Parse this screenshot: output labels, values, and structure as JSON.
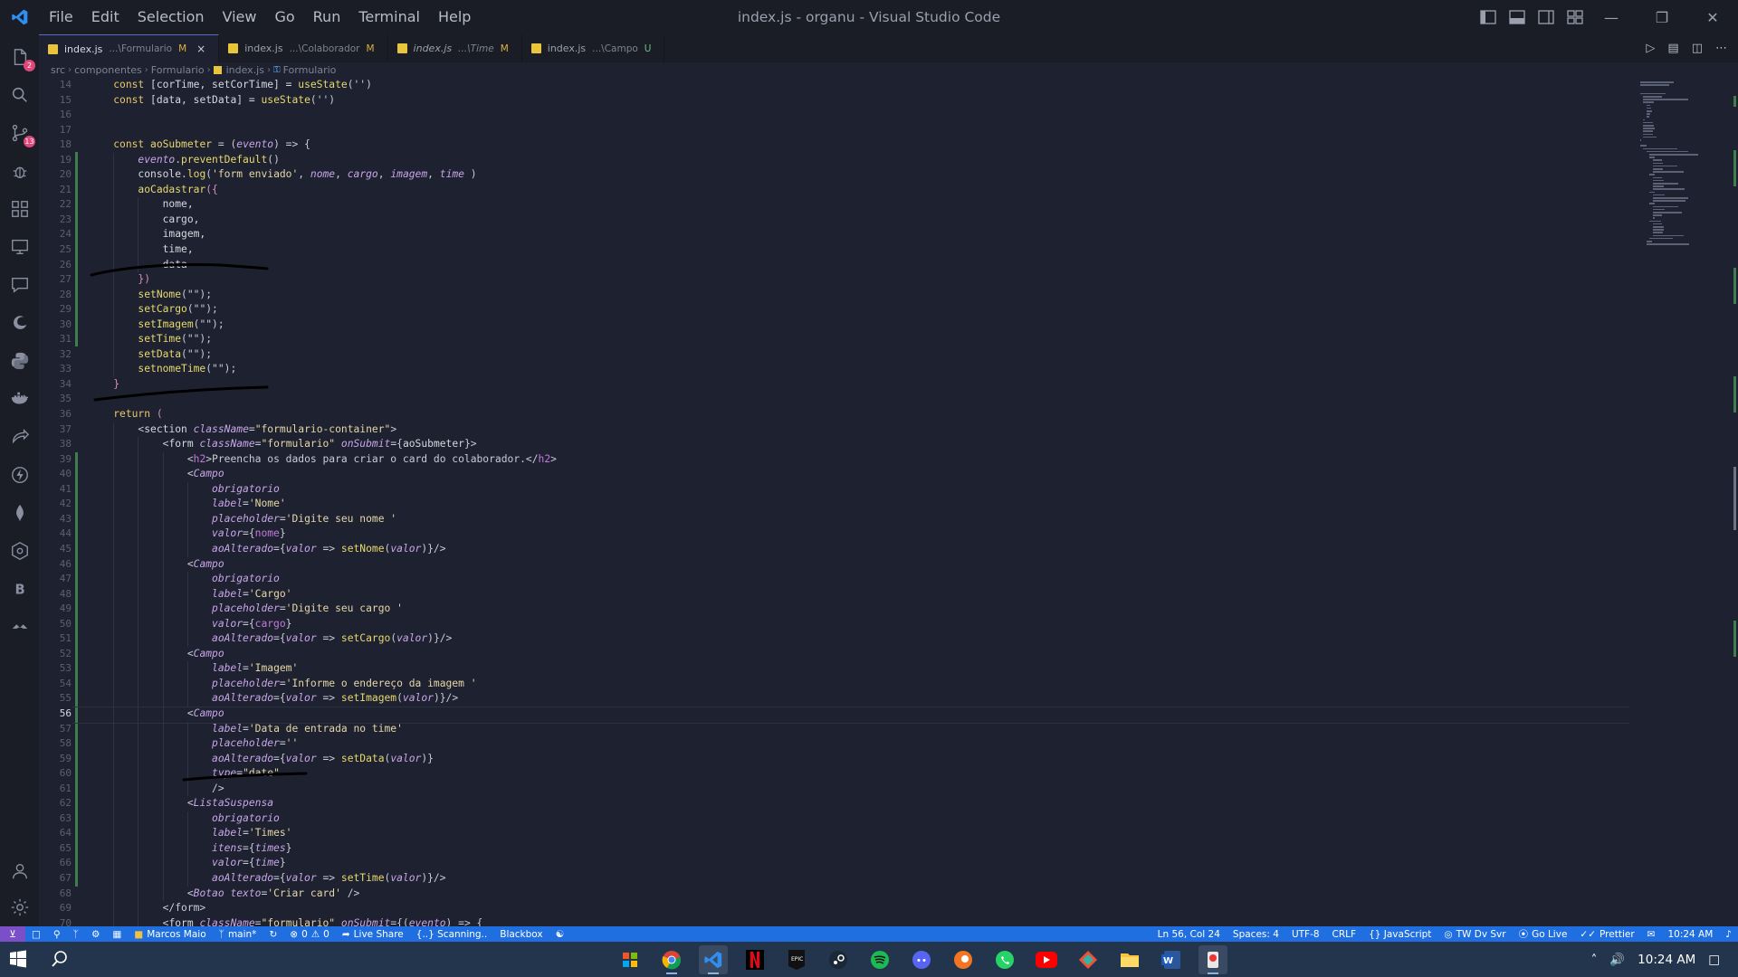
{
  "window": {
    "title": "index.js - organu - Visual Studio Code"
  },
  "menu": [
    "File",
    "Edit",
    "Selection",
    "View",
    "Go",
    "Run",
    "Terminal",
    "Help"
  ],
  "activity_badges": {
    "explorer": "2",
    "scm": "13"
  },
  "tabs": [
    {
      "name": "index.js",
      "path": "...\\Formulario",
      "status": "M",
      "active": true,
      "italic": false,
      "close": "×"
    },
    {
      "name": "index.js",
      "path": "...\\Colaborador",
      "status": "M",
      "active": false,
      "italic": false,
      "close": ""
    },
    {
      "name": "index.js",
      "path": "...\\Time",
      "status": "M",
      "active": false,
      "italic": true,
      "close": ""
    },
    {
      "name": "index.js",
      "path": "...\\Campo",
      "status": "U",
      "active": false,
      "italic": false,
      "close": ""
    }
  ],
  "breadcrumb": [
    "src",
    "componentes",
    "Formulario",
    "index.js",
    "Formulario"
  ],
  "editor": {
    "first_line": 14,
    "current_line": 56,
    "lines": [
      [
        [
          "    ",
          "p"
        ],
        [
          "const ",
          "kw"
        ],
        [
          "[corTime, setCorTime] = ",
          "v"
        ],
        [
          "useState",
          "fn"
        ],
        [
          "('')",
          "p"
        ]
      ],
      [
        [
          "    ",
          "p"
        ],
        [
          "const ",
          "kw"
        ],
        [
          "[data, setData] = ",
          "v"
        ],
        [
          "useState",
          "fn"
        ],
        [
          "('')",
          "p"
        ]
      ],
      [],
      [],
      [
        [
          "    ",
          "p"
        ],
        [
          "const ",
          "kw"
        ],
        [
          "aoSubmeter",
          "fn"
        ],
        [
          " = (",
          "p"
        ],
        [
          "evento",
          "it"
        ],
        [
          ") => {",
          "p"
        ]
      ],
      [
        [
          "        ",
          "p"
        ],
        [
          "evento",
          "it"
        ],
        [
          ".",
          "p"
        ],
        [
          "preventDefault",
          "fn"
        ],
        [
          "()",
          "p"
        ]
      ],
      [
        [
          "        ",
          "p"
        ],
        [
          "console",
          "v"
        ],
        [
          ".",
          "p"
        ],
        [
          "log",
          "fn"
        ],
        [
          "(",
          "p"
        ],
        [
          "'form enviado'",
          "str"
        ],
        [
          ", ",
          "p"
        ],
        [
          "nome",
          "it"
        ],
        [
          ", ",
          "p"
        ],
        [
          "cargo",
          "it"
        ],
        [
          ", ",
          "p"
        ],
        [
          "imagem",
          "it"
        ],
        [
          ", ",
          "p"
        ],
        [
          "time",
          "it"
        ],
        [
          " )",
          "p"
        ]
      ],
      [
        [
          "        ",
          "p"
        ],
        [
          "aoCadastrar",
          "fn"
        ],
        [
          "({",
          "br"
        ]
      ],
      [
        [
          "            ",
          "p"
        ],
        [
          "nome,",
          "v"
        ]
      ],
      [
        [
          "            ",
          "p"
        ],
        [
          "cargo,",
          "v"
        ]
      ],
      [
        [
          "            ",
          "p"
        ],
        [
          "imagem,",
          "v"
        ]
      ],
      [
        [
          "            ",
          "p"
        ],
        [
          "time,",
          "v"
        ]
      ],
      [
        [
          "            ",
          "p"
        ],
        [
          "data",
          "v"
        ]
      ],
      [
        [
          "        ",
          "p"
        ],
        [
          "})",
          "br"
        ]
      ],
      [
        [
          "        ",
          "p"
        ],
        [
          "setNome",
          "fn"
        ],
        [
          "(\"\");",
          "p"
        ]
      ],
      [
        [
          "        ",
          "p"
        ],
        [
          "setCargo",
          "fn"
        ],
        [
          "(\"\");",
          "p"
        ]
      ],
      [
        [
          "        ",
          "p"
        ],
        [
          "setImagem",
          "fn"
        ],
        [
          "(\"\");",
          "p"
        ]
      ],
      [
        [
          "        ",
          "p"
        ],
        [
          "setTime",
          "fn"
        ],
        [
          "(\"\");",
          "p"
        ]
      ],
      [
        [
          "        ",
          "p"
        ],
        [
          "setData",
          "fn"
        ],
        [
          "(\"\");",
          "p"
        ]
      ],
      [
        [
          "        ",
          "p"
        ],
        [
          "setnomeTime",
          "fn"
        ],
        [
          "(\"\");",
          "p"
        ]
      ],
      [
        [
          "    ",
          "p"
        ],
        [
          "}",
          "br"
        ]
      ],
      [],
      [
        [
          "    ",
          "p"
        ],
        [
          "return ",
          "kw"
        ],
        [
          "(",
          "br"
        ]
      ],
      [
        [
          "        ",
          "p"
        ],
        [
          "<",
          "p"
        ],
        [
          "section ",
          "v"
        ],
        [
          "className",
          "attr"
        ],
        [
          "=",
          "p"
        ],
        [
          "\"formulario-container\"",
          "str"
        ],
        [
          ">",
          "p"
        ]
      ],
      [
        [
          "            ",
          "p"
        ],
        [
          "<",
          "p"
        ],
        [
          "form ",
          "v"
        ],
        [
          "className",
          "attr"
        ],
        [
          "=",
          "p"
        ],
        [
          "\"formulario\" ",
          "str"
        ],
        [
          "onSubmit",
          "attr"
        ],
        [
          "={",
          "p"
        ],
        [
          "aoSubmeter",
          "v"
        ],
        [
          "}>",
          "p"
        ]
      ],
      [
        [
          "                ",
          "p"
        ],
        [
          "<",
          "p"
        ],
        [
          "h2",
          "pl"
        ],
        [
          ">Preencha os dados para criar o card do colaborador.</",
          "p"
        ],
        [
          "h2",
          "pl"
        ],
        [
          ">",
          "p"
        ]
      ],
      [
        [
          "                ",
          "p"
        ],
        [
          "<",
          "p"
        ],
        [
          "Campo",
          "tag"
        ]
      ],
      [
        [
          "                    ",
          "p"
        ],
        [
          "obrigatorio",
          "attr"
        ]
      ],
      [
        [
          "                    ",
          "p"
        ],
        [
          "label",
          "attr"
        ],
        [
          "=",
          "p"
        ],
        [
          "'Nome'",
          "str"
        ]
      ],
      [
        [
          "                    ",
          "p"
        ],
        [
          "placeholder",
          "attr"
        ],
        [
          "=",
          "p"
        ],
        [
          "'Digite seu nome '",
          "str"
        ]
      ],
      [
        [
          "                    ",
          "p"
        ],
        [
          "valor",
          "attr"
        ],
        [
          "={",
          "p"
        ],
        [
          "nome",
          "pl"
        ],
        [
          "}",
          "p"
        ]
      ],
      [
        [
          "                    ",
          "p"
        ],
        [
          "aoAlterado",
          "attr"
        ],
        [
          "={",
          "p"
        ],
        [
          "valor",
          "it"
        ],
        [
          " => ",
          "p"
        ],
        [
          "setNome",
          "fn"
        ],
        [
          "(",
          "p"
        ],
        [
          "valor",
          "it"
        ],
        [
          ")}/>",
          "p"
        ]
      ],
      [
        [
          "                ",
          "p"
        ],
        [
          "<",
          "p"
        ],
        [
          "Campo",
          "tag"
        ]
      ],
      [
        [
          "                    ",
          "p"
        ],
        [
          "obrigatorio",
          "attr"
        ]
      ],
      [
        [
          "                    ",
          "p"
        ],
        [
          "label",
          "attr"
        ],
        [
          "=",
          "p"
        ],
        [
          "'Cargo'",
          "str"
        ]
      ],
      [
        [
          "                    ",
          "p"
        ],
        [
          "placeholder",
          "attr"
        ],
        [
          "=",
          "p"
        ],
        [
          "'Digite seu cargo '",
          "str"
        ]
      ],
      [
        [
          "                    ",
          "p"
        ],
        [
          "valor",
          "attr"
        ],
        [
          "={",
          "p"
        ],
        [
          "cargo",
          "pl"
        ],
        [
          "}",
          "p"
        ]
      ],
      [
        [
          "                    ",
          "p"
        ],
        [
          "aoAlterado",
          "attr"
        ],
        [
          "={",
          "p"
        ],
        [
          "valor",
          "it"
        ],
        [
          " => ",
          "p"
        ],
        [
          "setCargo",
          "fn"
        ],
        [
          "(",
          "p"
        ],
        [
          "valor",
          "it"
        ],
        [
          ")}/>",
          "p"
        ]
      ],
      [
        [
          "                ",
          "p"
        ],
        [
          "<",
          "p"
        ],
        [
          "Campo",
          "tag"
        ]
      ],
      [
        [
          "                    ",
          "p"
        ],
        [
          "label",
          "attr"
        ],
        [
          "=",
          "p"
        ],
        [
          "'Imagem'",
          "str"
        ]
      ],
      [
        [
          "                    ",
          "p"
        ],
        [
          "placeholder",
          "attr"
        ],
        [
          "=",
          "p"
        ],
        [
          "'Informe o endereço da imagem '",
          "str"
        ]
      ],
      [
        [
          "                    ",
          "p"
        ],
        [
          "aoAlterado",
          "attr"
        ],
        [
          "={",
          "p"
        ],
        [
          "valor",
          "it"
        ],
        [
          " => ",
          "p"
        ],
        [
          "setImagem",
          "fn"
        ],
        [
          "(",
          "p"
        ],
        [
          "valor",
          "it"
        ],
        [
          ")}/>",
          "p"
        ]
      ],
      [
        [
          "                ",
          "p"
        ],
        [
          "<",
          "p"
        ],
        [
          "Campo",
          "tag"
        ]
      ],
      [
        [
          "                    ",
          "p"
        ],
        [
          "label",
          "attr"
        ],
        [
          "=",
          "p"
        ],
        [
          "'Data de entrada no time'",
          "str"
        ]
      ],
      [
        [
          "                    ",
          "p"
        ],
        [
          "placeholder",
          "attr"
        ],
        [
          "=",
          "p"
        ],
        [
          "''",
          "str"
        ]
      ],
      [
        [
          "                    ",
          "p"
        ],
        [
          "aoAlterado",
          "attr"
        ],
        [
          "={",
          "p"
        ],
        [
          "valor",
          "it"
        ],
        [
          " => ",
          "p"
        ],
        [
          "setData",
          "fn"
        ],
        [
          "(",
          "p"
        ],
        [
          "valor",
          "it"
        ],
        [
          ")}",
          "p"
        ]
      ],
      [
        [
          "                    ",
          "p"
        ],
        [
          "type",
          "attr"
        ],
        [
          "=",
          "p"
        ],
        [
          "\"date\"",
          "str"
        ]
      ],
      [
        [
          "                    ",
          "p"
        ],
        [
          "/>",
          "p"
        ]
      ],
      [
        [
          "                ",
          "p"
        ],
        [
          "<",
          "p"
        ],
        [
          "ListaSuspensa",
          "tag"
        ]
      ],
      [
        [
          "                    ",
          "p"
        ],
        [
          "obrigatorio",
          "attr"
        ]
      ],
      [
        [
          "                    ",
          "p"
        ],
        [
          "label",
          "attr"
        ],
        [
          "=",
          "p"
        ],
        [
          "'Times'",
          "str"
        ]
      ],
      [
        [
          "                    ",
          "p"
        ],
        [
          "itens",
          "attr"
        ],
        [
          "={",
          "p"
        ],
        [
          "times",
          "it"
        ],
        [
          "}",
          "p"
        ]
      ],
      [
        [
          "                    ",
          "p"
        ],
        [
          "valor",
          "attr"
        ],
        [
          "={",
          "p"
        ],
        [
          "time",
          "it"
        ],
        [
          "}",
          "p"
        ]
      ],
      [
        [
          "                    ",
          "p"
        ],
        [
          "aoAlterado",
          "attr"
        ],
        [
          "={",
          "p"
        ],
        [
          "valor",
          "it"
        ],
        [
          " => ",
          "p"
        ],
        [
          "setTime",
          "fn"
        ],
        [
          "(",
          "p"
        ],
        [
          "valor",
          "it"
        ],
        [
          ")}/>",
          "p"
        ]
      ],
      [
        [
          "                ",
          "p"
        ],
        [
          "<",
          "p"
        ],
        [
          "Botao ",
          "tag"
        ],
        [
          "texto",
          "attr"
        ],
        [
          "=",
          "p"
        ],
        [
          "'Criar card'",
          "str"
        ],
        [
          " />",
          "p"
        ]
      ],
      [
        [
          "            ",
          "p"
        ],
        [
          "</form>",
          "p"
        ]
      ],
      [
        [
          "            ",
          "p"
        ],
        [
          "<",
          "p"
        ],
        [
          "form ",
          "v"
        ],
        [
          "className",
          "attr"
        ],
        [
          "=",
          "p"
        ],
        [
          "\"formulario\" ",
          "str"
        ],
        [
          "onSubmit",
          "attr"
        ],
        [
          "={(",
          "p"
        ],
        [
          "evento",
          "it"
        ],
        [
          ") => {",
          "p"
        ]
      ]
    ]
  },
  "status_left": [
    "Marcos Maio",
    "main*",
    "0",
    "0",
    "Live Share",
    "{..} Scanning..",
    "Blackbox"
  ],
  "status_right": [
    "Ln 56, Col 24",
    "Spaces: 4",
    "UTF-8",
    "CRLF",
    "{} JavaScript",
    "TW Dv Svr",
    "Go Live",
    "Prettier",
    "10:24 AM"
  ],
  "taskbar": {
    "clock": "10:24 AM"
  },
  "colors": {
    "statusbar": "#1f6fe0",
    "editor_bg": "#1e2130",
    "taskbar": "#23344d"
  }
}
